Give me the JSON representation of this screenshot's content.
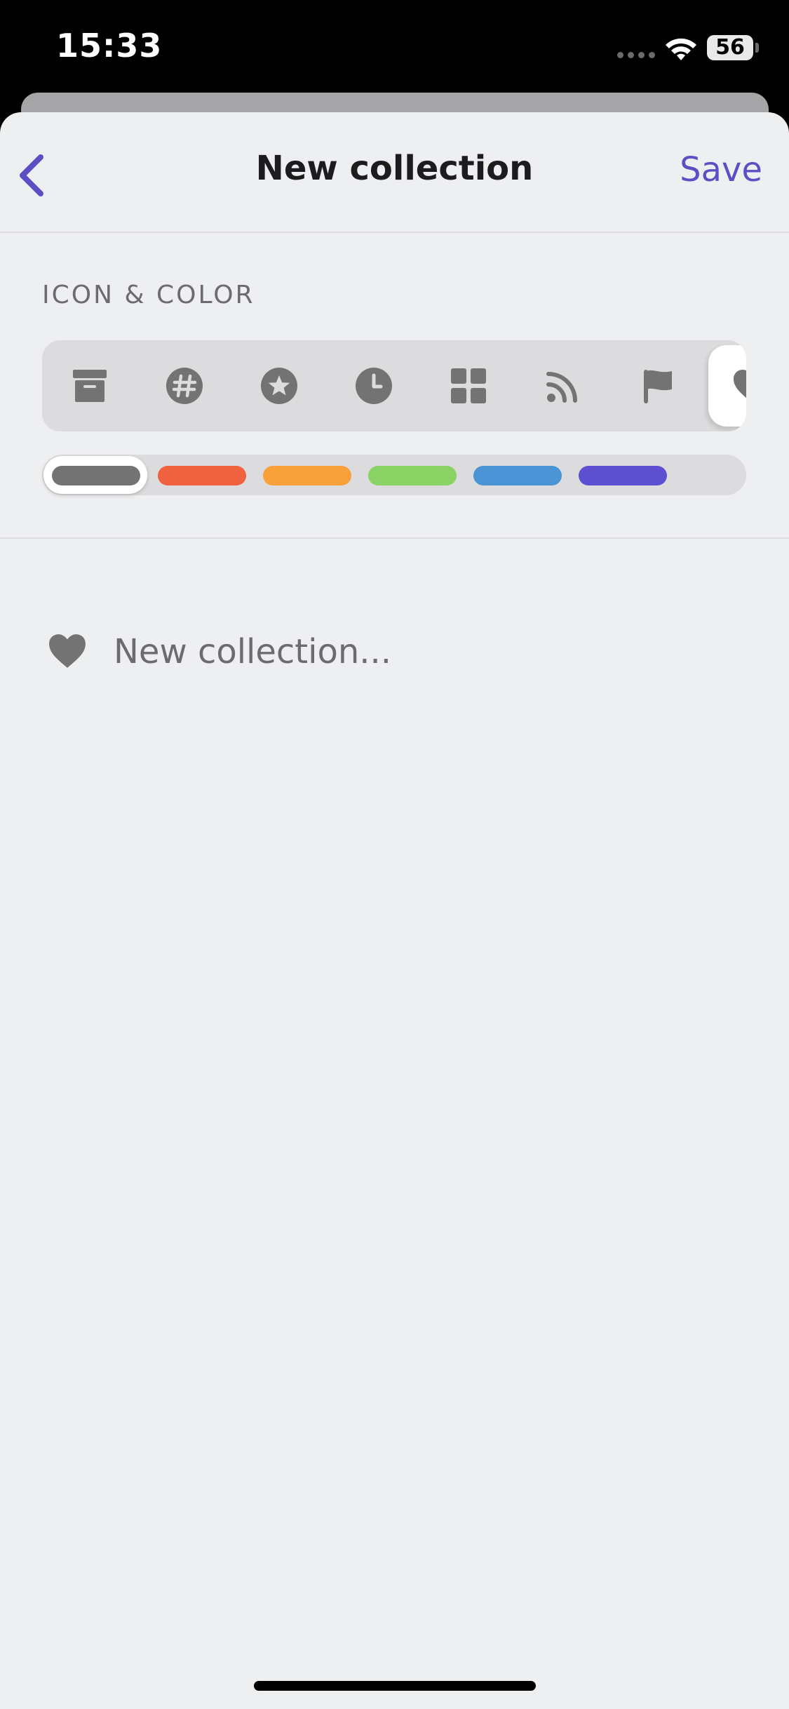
{
  "status_bar": {
    "time": "15:33",
    "battery": "56"
  },
  "nav": {
    "title": "New collection",
    "save_label": "Save",
    "back_icon": "chevron-left-icon"
  },
  "icon_color": {
    "section_label": "ICON & COLOR",
    "icons": [
      {
        "name": "archive-box-icon"
      },
      {
        "name": "hashtag-icon"
      },
      {
        "name": "star-icon"
      },
      {
        "name": "clock-icon"
      },
      {
        "name": "grid-icon"
      },
      {
        "name": "rss-icon"
      },
      {
        "name": "flag-icon"
      },
      {
        "name": "heart-icon",
        "selected": true
      }
    ],
    "colors": [
      {
        "name": "gray",
        "hex": "#737373",
        "selected": true
      },
      {
        "name": "red",
        "hex": "#f0613f"
      },
      {
        "name": "orange",
        "hex": "#f8a03a"
      },
      {
        "name": "green",
        "hex": "#8ad263"
      },
      {
        "name": "blue",
        "hex": "#4a93d4"
      },
      {
        "name": "purple",
        "hex": "#5e4fd1"
      }
    ]
  },
  "name_field": {
    "placeholder": "New collection...",
    "value": "",
    "icon": "heart-icon"
  },
  "theme": {
    "accent": "#5b4fc4",
    "icon_gray": "#737373"
  }
}
